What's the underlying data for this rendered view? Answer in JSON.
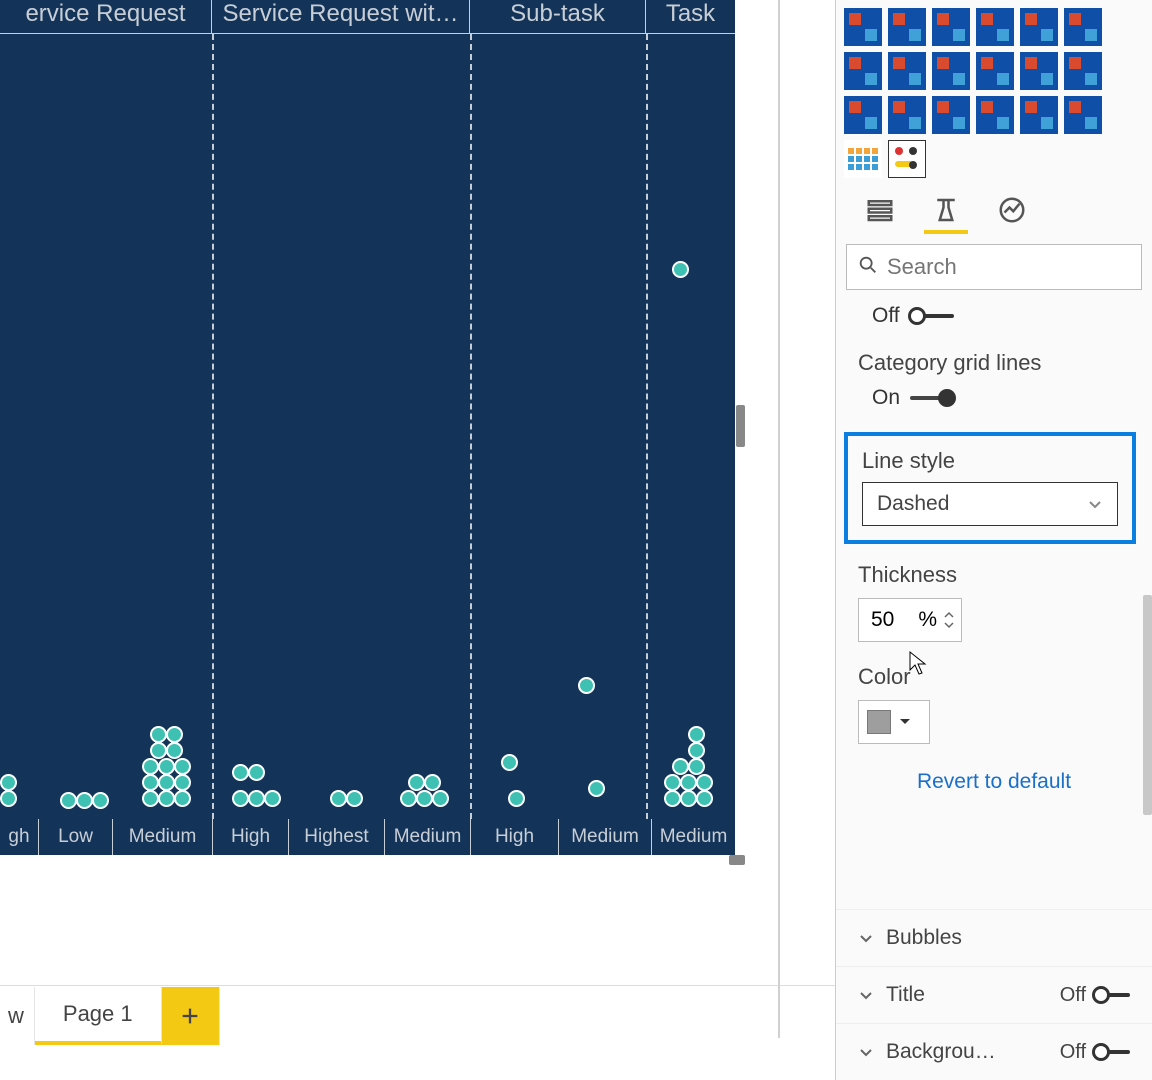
{
  "chart": {
    "columns": [
      "ervice Request",
      "Service Request wit…",
      "Sub-task",
      "Task"
    ],
    "xticks": [
      "gh",
      "Low",
      "Medium",
      "High",
      "Highest",
      "Medium",
      "High",
      "Medium",
      "Medium"
    ]
  },
  "tabs": {
    "partial": "w",
    "page1": "Page 1"
  },
  "panel": {
    "search_placeholder": "Search",
    "prev_toggle": "Off",
    "category_grid_lines": "Category grid lines",
    "category_toggle": "On",
    "line_style_label": "Line style",
    "line_style_value": "Dashed",
    "thickness_label": "Thickness",
    "thickness_value": "50",
    "thickness_unit": "%",
    "color_label": "Color",
    "revert": "Revert to default",
    "acc_bubbles": "Bubbles",
    "acc_title": "Title",
    "acc_title_toggle": "Off",
    "acc_background": "Backgrou…",
    "acc_background_toggle": "Off"
  }
}
